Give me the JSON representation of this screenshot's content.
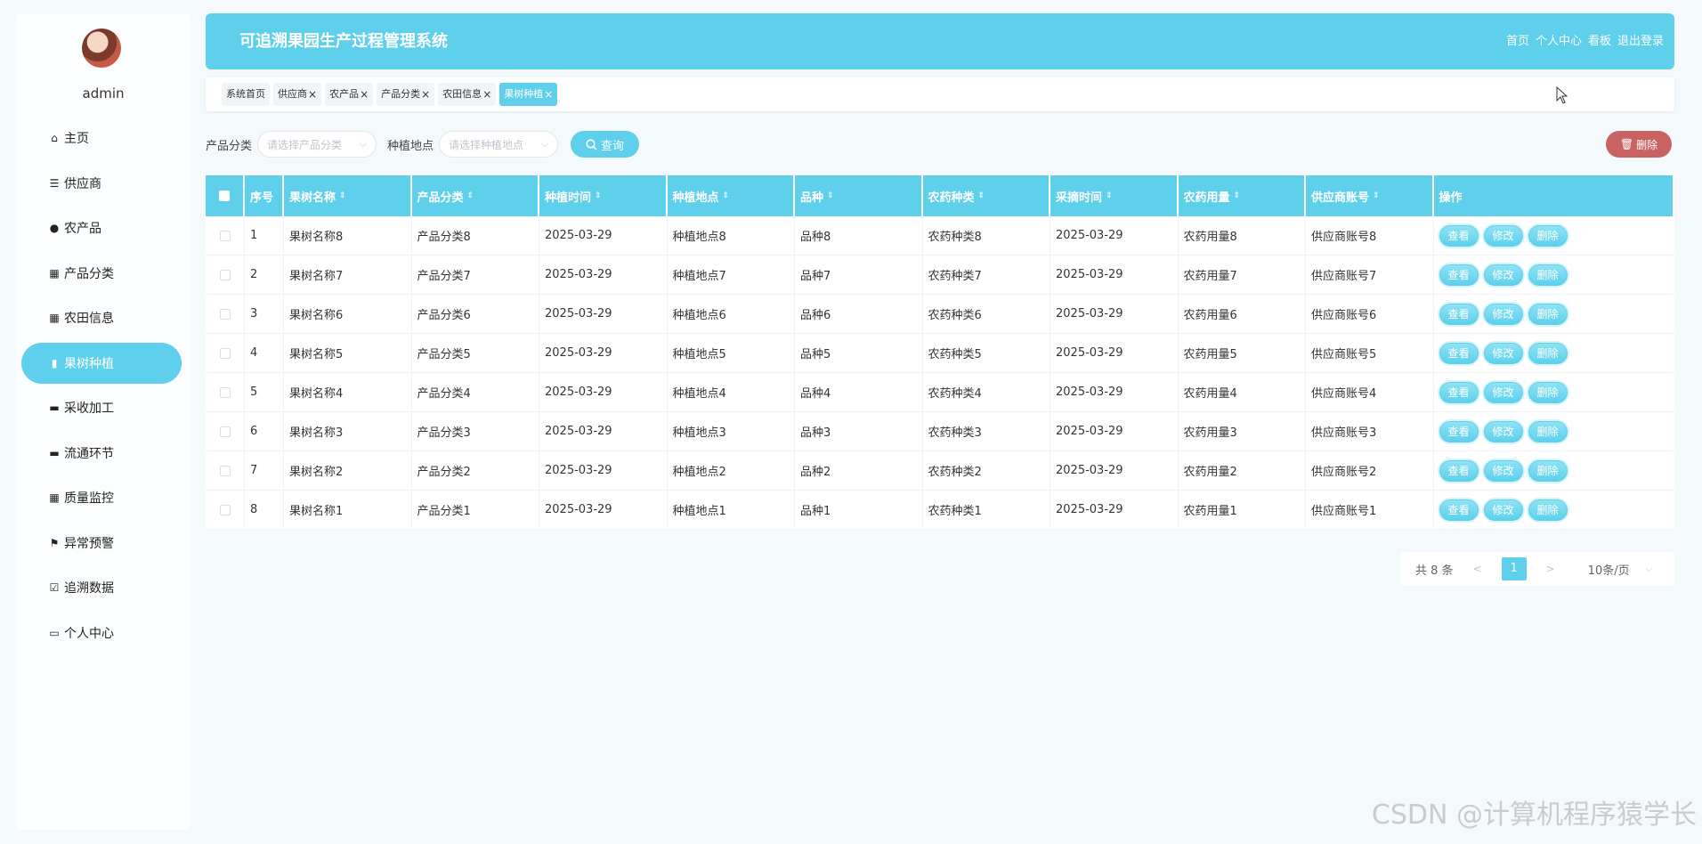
{
  "user": {
    "name": "admin"
  },
  "sidebar": {
    "items": [
      {
        "label": "主页",
        "icon": "home-icon",
        "glyph": "⌂"
      },
      {
        "label": "供应商",
        "icon": "sliders-icon",
        "glyph": "☰"
      },
      {
        "label": "农产品",
        "icon": "user-icon",
        "glyph": "●"
      },
      {
        "label": "产品分类",
        "icon": "grid-icon",
        "glyph": "▦"
      },
      {
        "label": "农田信息",
        "icon": "grid-icon",
        "glyph": "▦"
      },
      {
        "label": "果树种植",
        "icon": "clipboard-icon",
        "glyph": "▮",
        "active": true
      },
      {
        "label": "采收加工",
        "icon": "tray-icon",
        "glyph": "▬"
      },
      {
        "label": "流通环节",
        "icon": "monitor-icon",
        "glyph": "▬"
      },
      {
        "label": "质量监控",
        "icon": "grid-icon",
        "glyph": "▦"
      },
      {
        "label": "异常预警",
        "icon": "flag-icon",
        "glyph": "⚑"
      },
      {
        "label": "追溯数据",
        "icon": "checklist-icon",
        "glyph": "☑"
      },
      {
        "label": "个人中心",
        "icon": "card-icon",
        "glyph": "▭"
      }
    ]
  },
  "header": {
    "title": "可追溯果园生产过程管理系统",
    "nav": [
      "首页",
      "个人中心",
      "看板",
      "退出登录"
    ]
  },
  "tabs": [
    {
      "label": "系统首页",
      "closable": false
    },
    {
      "label": "供应商",
      "closable": true
    },
    {
      "label": "农产品",
      "closable": true
    },
    {
      "label": "产品分类",
      "closable": true
    },
    {
      "label": "农田信息",
      "closable": true
    },
    {
      "label": "果树种植",
      "closable": true,
      "active": true
    }
  ],
  "search": {
    "category_label": "产品分类",
    "category_placeholder": "请选择产品分类",
    "location_label": "种植地点",
    "location_placeholder": "请选择种植地点",
    "search_button": "查询",
    "delete_button": "删除"
  },
  "table": {
    "headers": [
      "序号",
      "果树名称",
      "产品分类",
      "种植时间",
      "种植地点",
      "品种",
      "农药种类",
      "采摘时间",
      "农药用量",
      "供应商账号",
      "操作"
    ],
    "sortable": [
      false,
      true,
      true,
      true,
      true,
      true,
      true,
      true,
      true,
      true,
      false
    ],
    "rows": [
      [
        "1",
        "果树名称8",
        "产品分类8",
        "2025-03-29",
        "种植地点8",
        "品种8",
        "农药种类8",
        "2025-03-29",
        "农药用量8",
        "供应商账号8"
      ],
      [
        "2",
        "果树名称7",
        "产品分类7",
        "2025-03-29",
        "种植地点7",
        "品种7",
        "农药种类7",
        "2025-03-29",
        "农药用量7",
        "供应商账号7"
      ],
      [
        "3",
        "果树名称6",
        "产品分类6",
        "2025-03-29",
        "种植地点6",
        "品种6",
        "农药种类6",
        "2025-03-29",
        "农药用量6",
        "供应商账号6"
      ],
      [
        "4",
        "果树名称5",
        "产品分类5",
        "2025-03-29",
        "种植地点5",
        "品种5",
        "农药种类5",
        "2025-03-29",
        "农药用量5",
        "供应商账号5"
      ],
      [
        "5",
        "果树名称4",
        "产品分类4",
        "2025-03-29",
        "种植地点4",
        "品种4",
        "农药种类4",
        "2025-03-29",
        "农药用量4",
        "供应商账号4"
      ],
      [
        "6",
        "果树名称3",
        "产品分类3",
        "2025-03-29",
        "种植地点3",
        "品种3",
        "农药种类3",
        "2025-03-29",
        "农药用量3",
        "供应商账号3"
      ],
      [
        "7",
        "果树名称2",
        "产品分类2",
        "2025-03-29",
        "种植地点2",
        "品种2",
        "农药种类2",
        "2025-03-29",
        "农药用量2",
        "供应商账号2"
      ],
      [
        "8",
        "果树名称1",
        "产品分类1",
        "2025-03-29",
        "种植地点1",
        "品种1",
        "农药种类1",
        "2025-03-29",
        "农药用量1",
        "供应商账号1"
      ]
    ],
    "row_actions": [
      "查看",
      "修改",
      "删除"
    ]
  },
  "pagination": {
    "total": "共 8 条",
    "current_page": "1",
    "prev": "<",
    "next": ">",
    "page_size": "10条/页"
  },
  "watermark": "CSDN @计算机程序猿学长",
  "colors": {
    "accent": "#5ed0ec",
    "danger": "#c96262"
  }
}
